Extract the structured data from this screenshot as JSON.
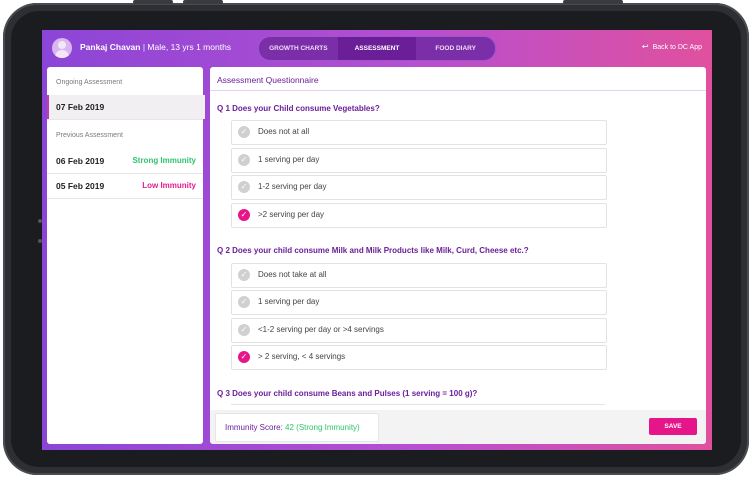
{
  "header": {
    "user_name": "Pankaj Chavan",
    "user_sep": " | ",
    "user_info": "Male, 13 yrs 1 months",
    "tabs": [
      {
        "label": "GROWTH CHARTS"
      },
      {
        "label": "ASSESSMENT"
      },
      {
        "label": "FOOD DIARY"
      }
    ],
    "active_tab": "ASSESSMENT",
    "back_label": "Back to DC App"
  },
  "sidebar": {
    "ongoing_label": "Ongoing Assessment",
    "ongoing_date": "07 Feb 2019",
    "previous_label": "Previous Assessment",
    "previous": [
      {
        "date": "06 Feb 2019",
        "status": "Strong Immunity",
        "status_color": "#2fc46b"
      },
      {
        "date": "05 Feb 2019",
        "status": "Low Immunity",
        "status_color": "#e21e8f"
      }
    ]
  },
  "main": {
    "title": "Assessment Questionnaire",
    "questions": [
      {
        "text": "Q 1 Does your Child consume Vegetables?",
        "options": [
          {
            "label": "Does not at all",
            "selected": false
          },
          {
            "label": "1 serving per day",
            "selected": false
          },
          {
            "label": "1-2 serving per day",
            "selected": false
          },
          {
            "label": ">2 serving per day",
            "selected": true
          }
        ]
      },
      {
        "text": "Q 2 Does your child consume Milk and Milk Products like Milk, Curd, Cheese etc.?",
        "options": [
          {
            "label": "Does not take at all",
            "selected": false
          },
          {
            "label": "1 serving per day",
            "selected": false
          },
          {
            "label": "<1-2 serving per day or >4 servings",
            "selected": false
          },
          {
            "label": "> 2 serving, < 4 servings",
            "selected": true
          }
        ]
      },
      {
        "text": "Q 3 Does your child consume Beans and Pulses (1 serving = 100 g)?",
        "options": []
      }
    ],
    "score_label": "Immunity Score:",
    "score_value": "42 (Strong Immunity)",
    "save_label": "SAVE"
  },
  "colors": {
    "accent_purple": "#6b1e99",
    "accent_pink": "#e6168a",
    "strong": "#2fc46b",
    "low": "#e21e8f"
  },
  "icons": {
    "check": "check-circle-icon",
    "back": "back-arrow-icon",
    "avatar": "user-avatar-icon"
  }
}
